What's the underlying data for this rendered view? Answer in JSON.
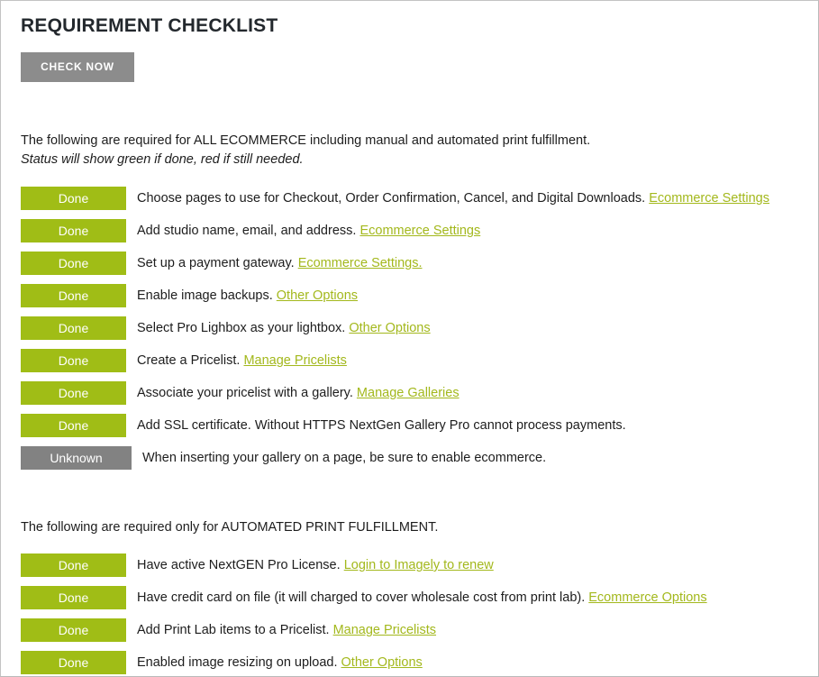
{
  "header": {
    "title": "REQUIREMENT CHECKLIST",
    "check_now_label": "CHECK NOW"
  },
  "intro": {
    "line1": "The following are required for ALL ECOMMERCE including manual and automated print fulfillment.",
    "line2": "Status will show green if done, red if still needed."
  },
  "sections": [
    {
      "id": "ecommerce",
      "rows": [
        {
          "status": "Done",
          "status_kind": "done",
          "text": "Choose pages to use for Checkout, Order Confirmation, Cancel, and Digital Downloads. ",
          "link": "Ecommerce Settings",
          "text_after": ""
        },
        {
          "status": "Done",
          "status_kind": "done",
          "text": "Add studio name, email, and address. ",
          "link": "Ecommerce Settings",
          "text_after": ""
        },
        {
          "status": "Done",
          "status_kind": "done",
          "text": "Set up a payment gateway. ",
          "link": "Ecommerce Settings.",
          "text_after": ""
        },
        {
          "status": "Done",
          "status_kind": "done",
          "text": "Enable image backups. ",
          "link": "Other Options",
          "text_after": ""
        },
        {
          "status": "Done",
          "status_kind": "done",
          "text": "Select Pro Lighbox as your lightbox. ",
          "link": "Other Options",
          "text_after": ""
        },
        {
          "status": "Done",
          "status_kind": "done",
          "text": "Create a Pricelist. ",
          "link": "Manage Pricelists",
          "text_after": ""
        },
        {
          "status": "Done",
          "status_kind": "done",
          "text": "Associate your pricelist with a gallery. ",
          "link": "Manage Galleries",
          "text_after": ""
        },
        {
          "status": "Done",
          "status_kind": "done",
          "text": "Add SSL certificate. Without HTTPS NextGen Gallery Pro cannot process payments.",
          "link": "",
          "text_after": ""
        },
        {
          "status": "Unknown",
          "status_kind": "unknown",
          "text": "When inserting your gallery on a page, be sure to enable ecommerce.",
          "link": "",
          "text_after": ""
        }
      ]
    },
    {
      "id": "automated-print",
      "title": "The following are required only for AUTOMATED PRINT FULFILLMENT.",
      "rows": [
        {
          "status": "Done",
          "status_kind": "done",
          "text": "Have active NextGEN Pro License. ",
          "link": "Login to Imagely to renew",
          "text_after": ""
        },
        {
          "status": "Done",
          "status_kind": "done",
          "text": "Have credit card on file (it will charged to cover wholesale cost from print lab). ",
          "link": "Ecommerce Options",
          "text_after": ""
        },
        {
          "status": "Done",
          "status_kind": "done",
          "text": "Add Print Lab items to a Pricelist. ",
          "link": "Manage Pricelists",
          "text_after": ""
        },
        {
          "status": "Done",
          "status_kind": "done",
          "text": "Enabled image resizing on upload. ",
          "link": "Other Options",
          "text_after": ""
        }
      ]
    }
  ],
  "colors": {
    "status_done": "#a0bd16",
    "status_unknown": "#828282",
    "button": "#8c8c8c",
    "link": "#a3b81c",
    "text": "#1d1d1d"
  }
}
